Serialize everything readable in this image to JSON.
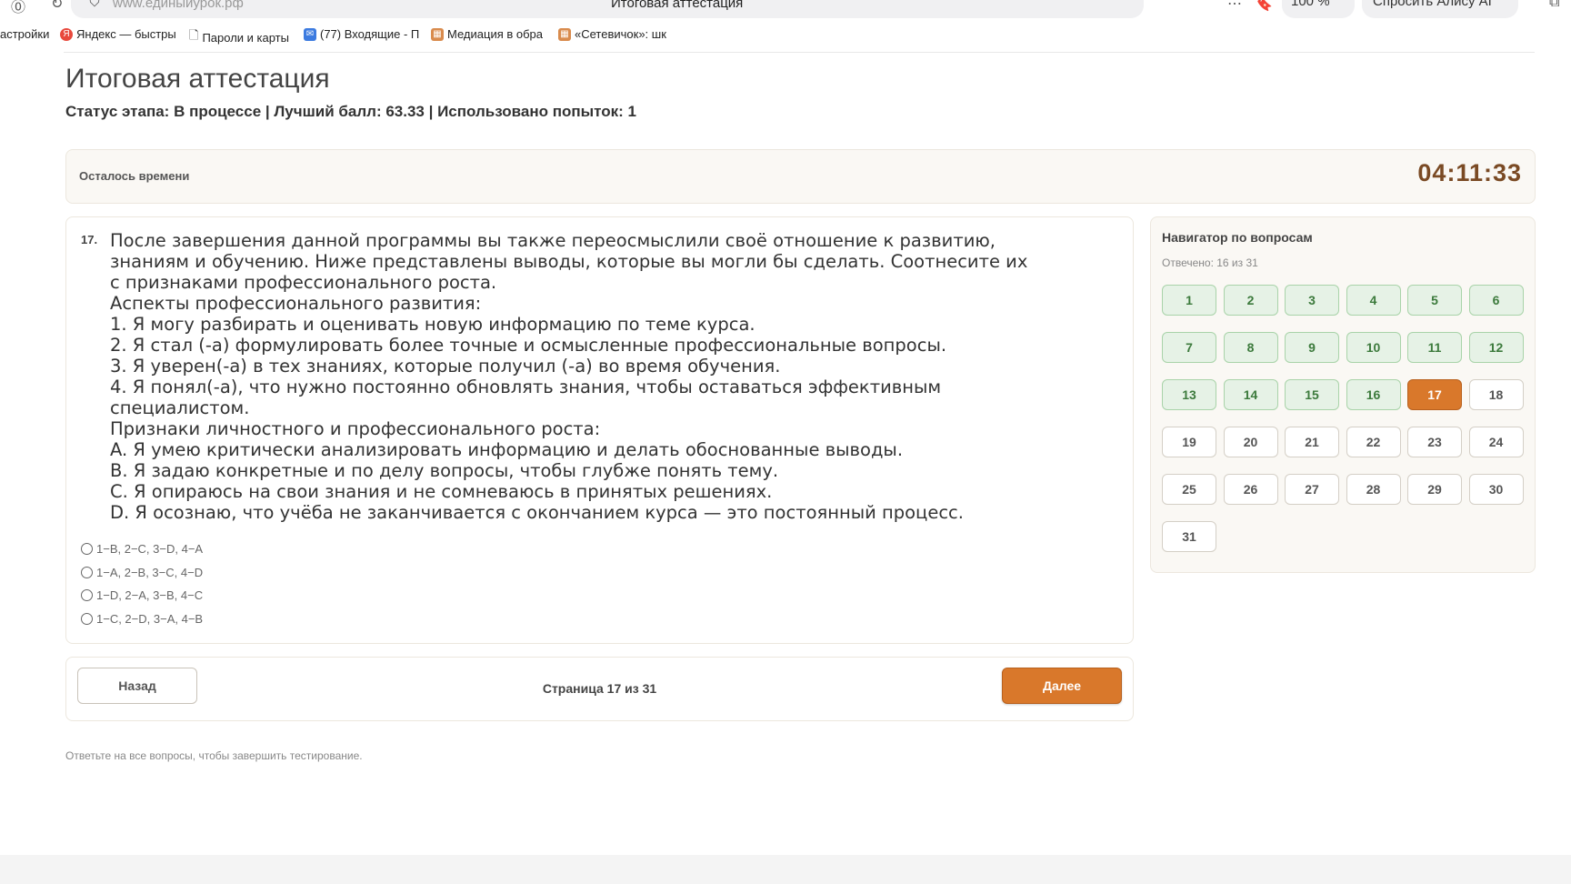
{
  "browser": {
    "url": "www.единыйурок.рф",
    "tab_title": "Итоговая аттестация",
    "zoom": "100 %",
    "alice": "Спросить Алису AI",
    "bookmarks": [
      {
        "label": "астройки"
      },
      {
        "label": "Яндекс — быстры"
      },
      {
        "label": "Пароли и карты"
      },
      {
        "label": "(77) Входящие - П"
      },
      {
        "label": "Медиация в обра"
      },
      {
        "label": "«Сетевичок»: шк"
      }
    ]
  },
  "page": {
    "title": "Итоговая аттестация",
    "status": "Статус этапа: В процессе | Лучший балл: 63.33 | Использовано попыток: 1"
  },
  "timer": {
    "label": "Осталось времени",
    "value": "04:11:33"
  },
  "question": {
    "number": "17.",
    "lines": [
      "После завершения данной программы вы также переосмыслили своё отношение к развитию,",
      "знаниям и обучению. Ниже представлены выводы, которые вы могли бы сделать. Соотнесите их",
      "с признаками профессионального роста.",
      "Аспекты профессионального развития:",
      "1. Я могу разбирать и оценивать новую информацию по теме курса.",
      "2. Я стал (-а) формулировать более точные и осмысленные профессиональные вопросы.",
      "3. Я уверен(-а) в тех знаниях, которые получил (-а) во время обучения.",
      "4. Я понял(-а), что нужно постоянно обновлять знания, чтобы оставаться эффективным",
      "специалистом.",
      "Признаки личностного и профессионального роста:",
      "A. Я умею критически анализировать информацию и делать обоснованные выводы.",
      "B. Я задаю конкретные и по делу вопросы, чтобы глубже понять тему.",
      "C. Я опираюсь на свои знания и не сомневаюсь в принятых решениях.",
      "D. Я осознаю, что учёба не заканчивается с окончанием курса — это постоянный процесс."
    ],
    "options": [
      "1−B, 2−C, 3−D, 4−A",
      "1−A, 2−B, 3−C, 4−D",
      "1−D, 2−A, 3−B, 4−C",
      "1−C, 2−D, 3−A, 4−B"
    ]
  },
  "pagination": {
    "back": "Назад",
    "indicator": "Страница 17 из 31",
    "next": "Далее"
  },
  "footer_note": "Ответьте на все вопросы, чтобы завершить тестирование.",
  "navigator": {
    "title": "Навигатор по вопросам",
    "answered_text": "Отвечено: 16 из 31",
    "current": 17,
    "answered": [
      1,
      2,
      3,
      4,
      5,
      6,
      7,
      8,
      9,
      10,
      11,
      12,
      13,
      14,
      15,
      16
    ],
    "total": 31,
    "colors": {
      "answered_bg": "#e6f2e6",
      "current_bg": "#d9782b"
    }
  }
}
